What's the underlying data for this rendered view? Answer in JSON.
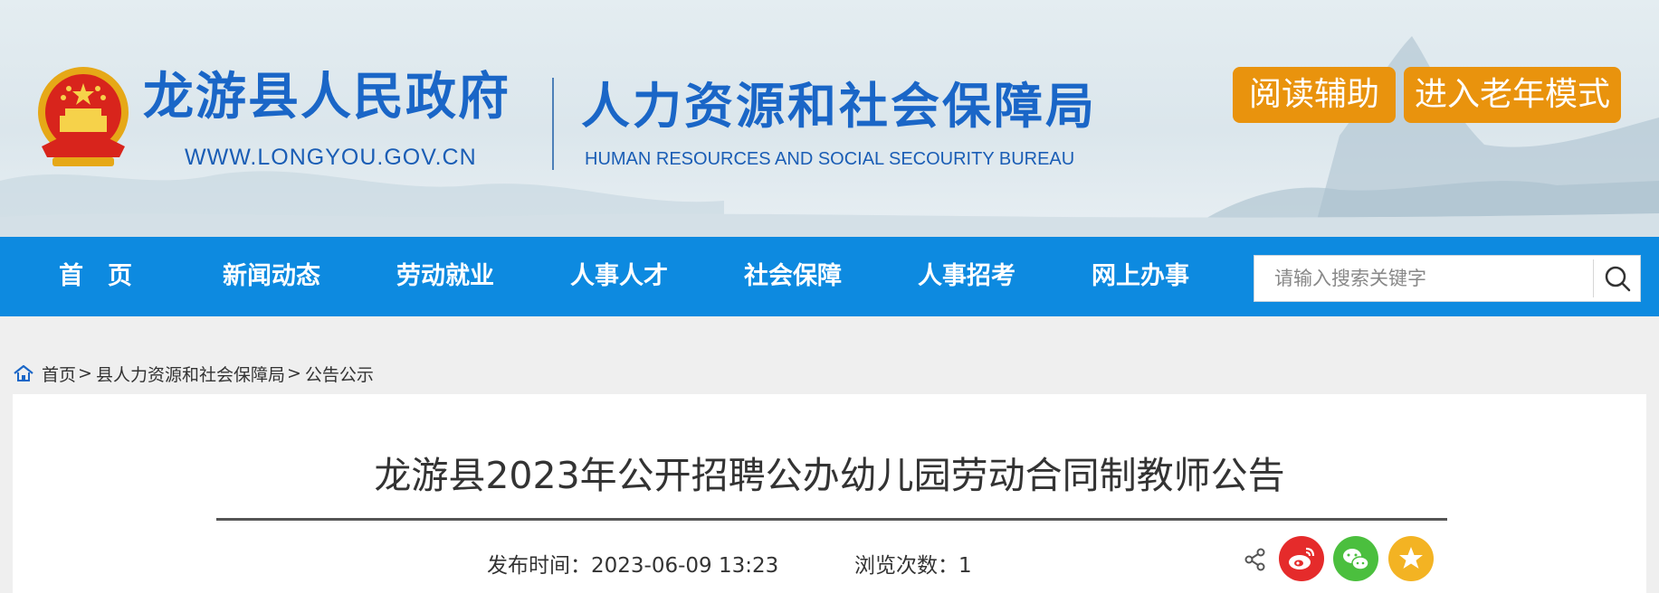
{
  "header": {
    "gov_name": "龙游县人民政府",
    "gov_url": "WWW.LONGYOU.GOV.CN",
    "bureau_name": "人力资源和社会保障局",
    "bureau_en": "HUMAN RESOURCES AND SOCIAL SECOURITY BUREAU",
    "reading_aid": "阅读辅助",
    "elder_mode": "进入老年模式",
    "emblem_icon": "national-emblem-icon",
    "colors": {
      "title": "#1a66c7",
      "button": "#e9930d"
    }
  },
  "nav": {
    "items": [
      "首　页",
      "新闻动态",
      "劳动就业",
      "人事人才",
      "社会保障",
      "人事招考",
      "网上办事"
    ],
    "search_placeholder": "请输入搜索关键字",
    "search_icon": "search-icon",
    "color": "#0d8ae0"
  },
  "breadcrumb": {
    "home": "首页",
    "level1": "县人力资源和社会保障局",
    "level2": "公告公示",
    "separator": ">"
  },
  "article": {
    "title": "龙游县2023年公开招聘公办幼儿园劳动合同制教师公告",
    "publish_time": "发布时间：2023-06-09 13:23",
    "views": "浏览次数：1",
    "share_icons": [
      "share-icon",
      "weibo-icon",
      "wechat-icon",
      "favorite-icon"
    ]
  }
}
